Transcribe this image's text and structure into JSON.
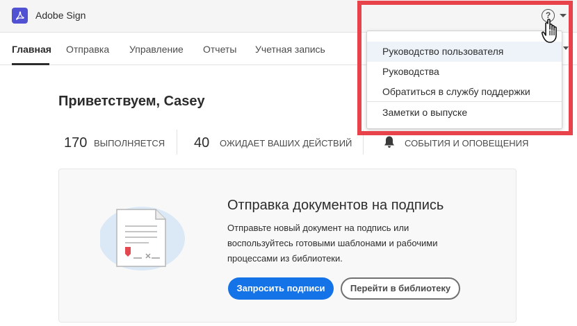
{
  "app": {
    "title": "Adobe Sign"
  },
  "nav": {
    "items": [
      {
        "label": "Главная",
        "active": true
      },
      {
        "label": "Отправка",
        "active": false
      },
      {
        "label": "Управление",
        "active": false
      },
      {
        "label": "Отчеты",
        "active": false
      },
      {
        "label": "Учетная запись",
        "active": false
      }
    ]
  },
  "greeting": "Приветствуем, Casey",
  "stats": [
    {
      "count": "170",
      "label": "Выполняется"
    },
    {
      "count": "40",
      "label": "Ожидает ваших действий"
    },
    {
      "label": "События и оповещения",
      "icon": "bell-icon"
    }
  ],
  "card": {
    "title": "Отправка документов на подпись",
    "body": "Отправьте новый документ на подпись или воспользуйтесь готовыми шаблонами и рабочими процессами из библиотеки.",
    "primary_button": "Запросить подписи",
    "secondary_button": "Перейти в библиотеку"
  },
  "help_menu": {
    "icon": "help-icon",
    "items": [
      {
        "label": "Руководство пользователя",
        "highlighted": true
      },
      {
        "label": "Руководства"
      },
      {
        "label": "Обратиться в службу поддержки"
      },
      {
        "label": "Заметки о выпуске"
      }
    ]
  },
  "colors": {
    "brand": "#5151d3",
    "primary_button": "#1473e6",
    "highlight_border": "#e8434a",
    "stamp_red": "#e34850"
  }
}
